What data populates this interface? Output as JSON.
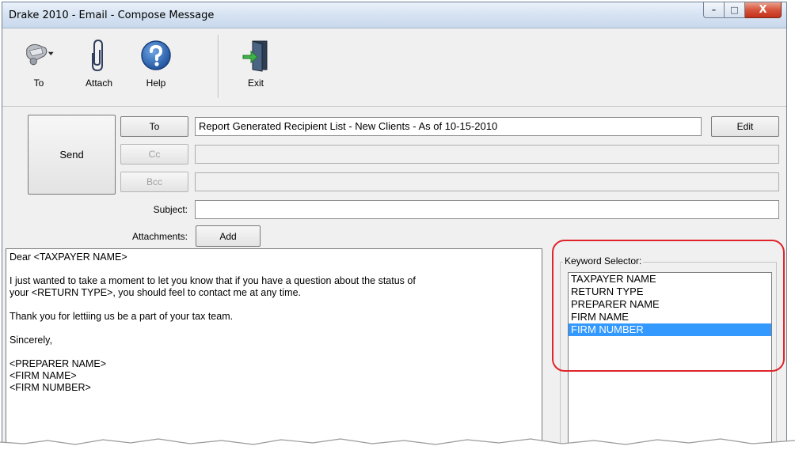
{
  "window": {
    "title": "Drake 2010 - Email - Compose Message",
    "controls": {
      "minimize": "–",
      "maximize": "□",
      "close": "X"
    }
  },
  "toolbar": {
    "to_label": "To",
    "attach_label": "Attach",
    "help_label": "Help",
    "exit_label": "Exit"
  },
  "compose": {
    "send_label": "Send",
    "to_button": "To",
    "cc_button": "Cc",
    "bcc_button": "Bcc",
    "to_value": "Report Generated Recipient List - New Clients - As of 10-15-2010",
    "cc_value": "",
    "bcc_value": "",
    "edit_label": "Edit",
    "subject_label": "Subject:",
    "subject_value": "",
    "attachments_label": "Attachments:",
    "add_label": "Add"
  },
  "message": {
    "lines": [
      "Dear <TAXPAYER NAME>",
      "",
      "I just wanted to take a moment to let you know that if you have a question about the status of",
      "your <RETURN TYPE>, you should feel to contact me at any time.",
      "",
      "Thank you for lettiing us be a part of your tax team.",
      "",
      "Sincerely,",
      "",
      "<PREPARER NAME>",
      "<FIRM NAME>",
      "<FIRM NUMBER>"
    ]
  },
  "keywords": {
    "label": "Keyword Selector:",
    "items": [
      "TAXPAYER NAME",
      "RETURN TYPE",
      "PREPARER NAME",
      "FIRM NAME",
      "FIRM NUMBER"
    ],
    "selected": "FIRM NUMBER"
  },
  "colors": {
    "selection": "#3399ff",
    "highlight_ring": "#e0242b",
    "close_button": "#c2301a"
  }
}
